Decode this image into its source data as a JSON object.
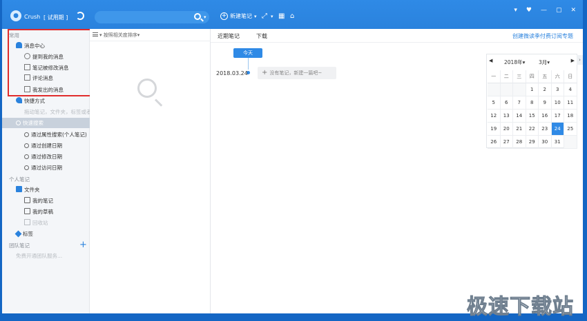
{
  "topbar": {
    "username": "Crush",
    "trial_label": "[ 试用期 ]",
    "search_placeholder": "",
    "new_note_label": "新建笔记",
    "window_controls": [
      "▾",
      "♥",
      "—",
      "▢",
      "✕"
    ]
  },
  "sidebar": {
    "common_title": "常用",
    "message_center": "消息中心",
    "message_items": [
      "提到我的消息",
      "笔记被修改消息",
      "评论消息",
      "我发出的消息"
    ],
    "shortcuts": "快捷方式",
    "shortcuts_hint": "拖动笔记，文件夹，标签或者",
    "quick_search": "快速搜索",
    "search_items": [
      "通过属性搜索(个人笔记)",
      "通过创建日期",
      "通过修改日期",
      "通过访问日期"
    ],
    "personal_title": "个人笔记",
    "folder": "文件夹",
    "folder_items": [
      "我的笔记",
      "我的草稿"
    ],
    "recycle": "回收站",
    "tags": "标签",
    "team_title": "团队笔记",
    "team_hint": "免费开通团队服务..."
  },
  "notelist": {
    "sort_label": "按照相关度排序"
  },
  "main": {
    "tabs": [
      "近期笔记",
      "下载"
    ],
    "right_link": "创建微读季付费订阅专题",
    "today_button": "今天",
    "timeline_date": "2018.03.24",
    "empty_note": "没有笔记，新建一篇吧~"
  },
  "calendar": {
    "year": "2018年▾",
    "month": "3月▾",
    "weekdays": [
      "一",
      "二",
      "三",
      "四",
      "五",
      "六",
      "日"
    ],
    "weeks": [
      [
        "",
        "",
        "",
        "1",
        "2",
        "3",
        "4"
      ],
      [
        "5",
        "6",
        "7",
        "8",
        "9",
        "10",
        "11"
      ],
      [
        "12",
        "13",
        "14",
        "15",
        "16",
        "17",
        "18"
      ],
      [
        "19",
        "20",
        "21",
        "22",
        "23",
        "24",
        "25"
      ],
      [
        "26",
        "27",
        "28",
        "29",
        "30",
        "31",
        ""
      ]
    ],
    "selected": "24"
  },
  "watermark": "极速下载站",
  "colors": {
    "accent": "#2a82dd",
    "highlight_box": "#e02b2b"
  }
}
